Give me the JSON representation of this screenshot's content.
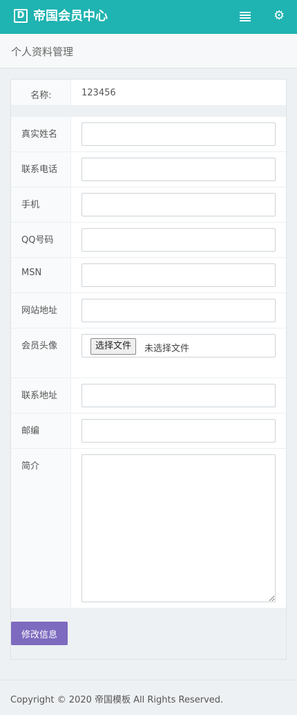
{
  "header": {
    "logo_letter": "D",
    "title": "帝国会员中心",
    "menu_icon": "list-icon",
    "settings_icon": "gear-icon",
    "bg_color": "#1fb3b1"
  },
  "page": {
    "title": "个人资料管理"
  },
  "profile": {
    "name_label": "名称:",
    "name_value": "123456",
    "fields": [
      {
        "label": "真实姓名",
        "value": ""
      },
      {
        "label": "联系电话",
        "value": ""
      },
      {
        "label": "手机",
        "value": ""
      },
      {
        "label": "QQ号码",
        "value": ""
      },
      {
        "label": "MSN",
        "value": ""
      },
      {
        "label": "网站地址",
        "value": ""
      }
    ],
    "avatar": {
      "label": "会员头像",
      "button": "选择文件",
      "status": "未选择文件"
    },
    "fields2": [
      {
        "label": "联系地址",
        "value": ""
      },
      {
        "label": "邮编",
        "value": ""
      }
    ],
    "bio": {
      "label": "简介",
      "value": ""
    },
    "submit_label": "修改信息",
    "submit_color": "#7d6bbf"
  },
  "footer": {
    "text": "Copyright © 2020 帝国模板 All Rights Reserved."
  }
}
